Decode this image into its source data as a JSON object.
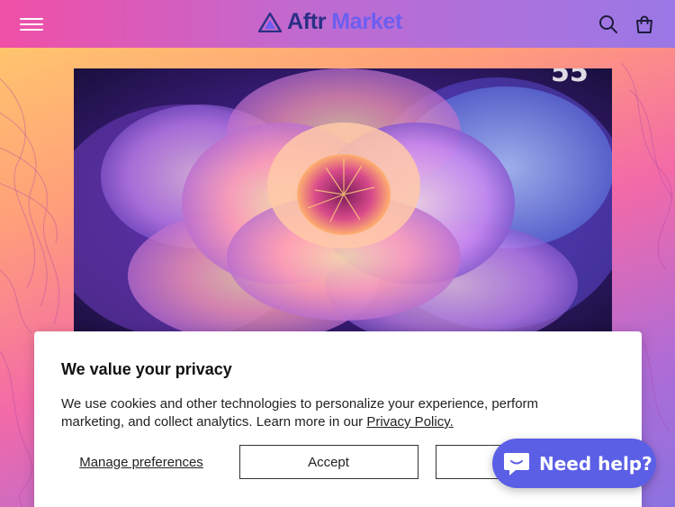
{
  "header": {
    "logo_left": "Aftr",
    "logo_right": "Market",
    "menu_icon": "hamburger-menu-icon",
    "search_icon": "search-icon",
    "cart_icon": "shopping-bag-icon"
  },
  "hero": {
    "tv_badge": "55"
  },
  "cookie": {
    "title": "We value your privacy",
    "text": "We use cookies and other technologies to personalize your experience, perform marketing, and collect analytics. Learn more in our",
    "link": "Privacy Policy.",
    "manage_label": "Manage preferences",
    "accept_label": "Accept"
  },
  "chat": {
    "label": "Need help?",
    "icon": "chat-bubble-icon"
  },
  "colors": {
    "header_gradient_start": "#f04fa6",
    "header_gradient_end": "#9a78e6",
    "logo_dark": "#2a2f86",
    "logo_accent": "#6d5ef0",
    "chat_bg": "#5b5fe6"
  }
}
